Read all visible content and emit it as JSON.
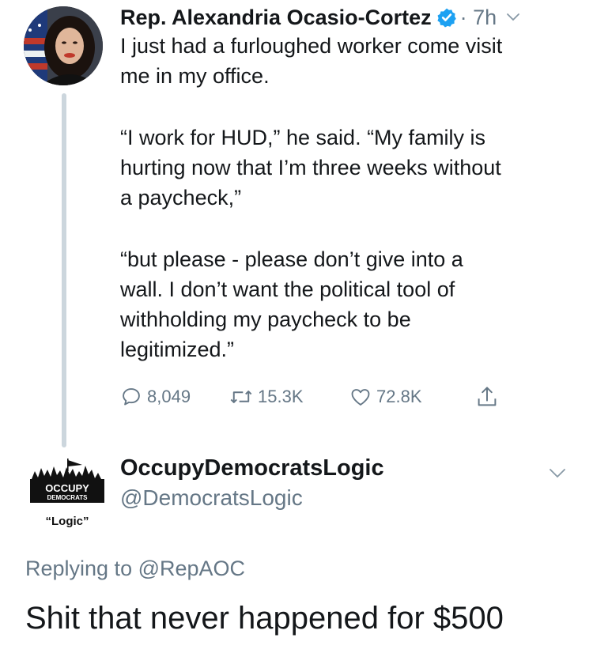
{
  "tweet1": {
    "display_name": "Rep. Alexandria Ocasio-Cortez",
    "verified_icon": "verified-badge-icon",
    "time": "· 7h",
    "lines": [
      "I just had a furloughed worker come visit",
      "me in my office.",
      "“I work for HUD,” he said. “My family is",
      "hurting now that I’m three weeks without",
      "a paycheck,”",
      "“but please - please don’t give into a",
      "wall. I don’t want the political tool of",
      "withholding my paycheck to be",
      "legitimized.”"
    ],
    "actions": {
      "reply_count": "8,049",
      "retweet_count": "15.3K",
      "like_count": "72.8K"
    }
  },
  "tweet2": {
    "avatar_text_top": "OCCUPY",
    "avatar_text_bottom": "DEMOCRATS",
    "avatar_caption": "“Logic”",
    "display_name": "OccupyDemocratsLogic",
    "handle": "@DemocratsLogic",
    "replying_prefix": "Replying to",
    "replying_to": "@RepAOC",
    "text": "Shit that never happened for $500"
  },
  "colors": {
    "text": "#14171a",
    "secondary": "#657786",
    "verified": "#1da1f2",
    "thread_line": "#ccd6dd"
  }
}
